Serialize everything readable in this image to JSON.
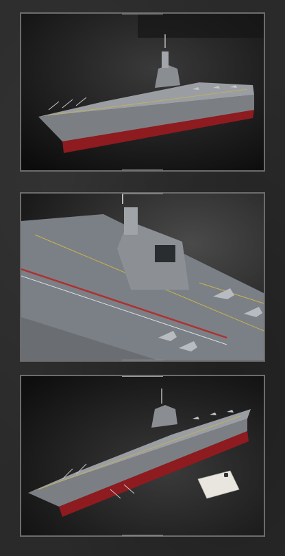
{
  "gallery": {
    "images": [
      {
        "name": "carrier-side-view"
      },
      {
        "name": "carrier-deck-closeup"
      },
      {
        "name": "carrier-with-phone-scale"
      }
    ]
  }
}
